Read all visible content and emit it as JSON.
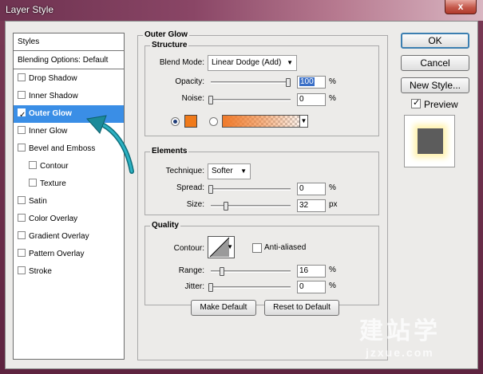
{
  "window": {
    "title": "Layer Style",
    "close_label": "x"
  },
  "styles_panel": {
    "header": "Styles",
    "blending": "Blending Options: Default",
    "items": [
      {
        "label": "Drop Shadow",
        "checked": false,
        "indent": false,
        "selected": false
      },
      {
        "label": "Inner Shadow",
        "checked": false,
        "indent": false,
        "selected": false
      },
      {
        "label": "Outer Glow",
        "checked": true,
        "indent": false,
        "selected": true
      },
      {
        "label": "Inner Glow",
        "checked": false,
        "indent": false,
        "selected": false
      },
      {
        "label": "Bevel and Emboss",
        "checked": false,
        "indent": false,
        "selected": false
      },
      {
        "label": "Contour",
        "checked": false,
        "indent": true,
        "selected": false
      },
      {
        "label": "Texture",
        "checked": false,
        "indent": true,
        "selected": false
      },
      {
        "label": "Satin",
        "checked": false,
        "indent": false,
        "selected": false
      },
      {
        "label": "Color Overlay",
        "checked": false,
        "indent": false,
        "selected": false
      },
      {
        "label": "Gradient Overlay",
        "checked": false,
        "indent": false,
        "selected": false
      },
      {
        "label": "Pattern Overlay",
        "checked": false,
        "indent": false,
        "selected": false
      },
      {
        "label": "Stroke",
        "checked": false,
        "indent": false,
        "selected": false
      }
    ]
  },
  "outer_glow": {
    "title": "Outer Glow",
    "structure": {
      "title": "Structure",
      "blend_mode_label": "Blend Mode:",
      "blend_mode_value": "Linear Dodge (Add)",
      "opacity_label": "Opacity:",
      "opacity_value": "100",
      "opacity_unit": "%",
      "noise_label": "Noise:",
      "noise_value": "0",
      "noise_unit": "%",
      "glow_color": "#f07a1a"
    },
    "elements": {
      "title": "Elements",
      "technique_label": "Technique:",
      "technique_value": "Softer",
      "spread_label": "Spread:",
      "spread_value": "0",
      "spread_unit": "%",
      "size_label": "Size:",
      "size_value": "32",
      "size_unit": "px"
    },
    "quality": {
      "title": "Quality",
      "contour_label": "Contour:",
      "anti_aliased_label": "Anti-aliased",
      "range_label": "Range:",
      "range_value": "16",
      "range_unit": "%",
      "jitter_label": "Jitter:",
      "jitter_value": "0",
      "jitter_unit": "%"
    },
    "make_default": "Make Default",
    "reset_default": "Reset to Default"
  },
  "buttons": {
    "ok": "OK",
    "cancel": "Cancel",
    "new_style": "New Style...",
    "preview_label": "Preview"
  },
  "watermark": {
    "cn": "建站学",
    "url": "jzxue.com"
  },
  "colors": {
    "selection": "#3a8ee6",
    "arrow": "#1b8a99",
    "glow": "#fff3b0"
  }
}
